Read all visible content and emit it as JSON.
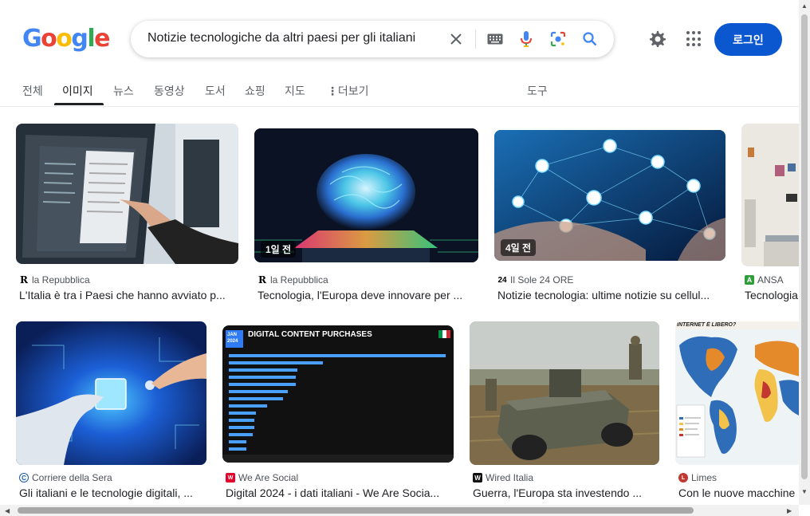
{
  "header": {
    "logo_letters": [
      {
        "ch": "G",
        "color": "#4285F4"
      },
      {
        "ch": "o",
        "color": "#EA4335"
      },
      {
        "ch": "o",
        "color": "#FBBC05"
      },
      {
        "ch": "g",
        "color": "#4285F4"
      },
      {
        "ch": "l",
        "color": "#34A853"
      },
      {
        "ch": "e",
        "color": "#EA4335"
      }
    ],
    "search_query": "Notizie tecnologiche da altri paesi per gli italiani",
    "login_label": "로그인"
  },
  "tabs": [
    {
      "label": "전체"
    },
    {
      "label": "이미지"
    },
    {
      "label": "뉴스"
    },
    {
      "label": "동영상"
    },
    {
      "label": "도서"
    },
    {
      "label": "쇼핑"
    },
    {
      "label": "지도"
    },
    {
      "label": "더보기"
    },
    {
      "label": "도구"
    }
  ],
  "results": [
    {
      "source": "la Repubblica",
      "title": "L'Italia è tra i Paesi che hanno avviato p...",
      "badge": ""
    },
    {
      "source": "la Repubblica",
      "title": "Tecnologia, l'Europa deve innovare per ...",
      "badge": "1일 전"
    },
    {
      "source": "Il Sole 24 ORE",
      "title": "Notizie tecnologia: ultime notizie su cellul...",
      "badge": "4일 전"
    },
    {
      "source": "ANSA",
      "title": "Tecnologia",
      "badge": ""
    },
    {
      "source": "Corriere della Sera",
      "title": "Gli italiani e le tecnologie digitali, ...",
      "badge": ""
    },
    {
      "source": "We Are Social",
      "title": "Digital 2024 - i dati italiani - We Are Socia...",
      "badge": "",
      "image_text": {
        "date": "JAN 2024",
        "heading": "DIGITAL CONTENT PURCHASES"
      }
    },
    {
      "source": "Wired Italia",
      "title": "Guerra, l'Europa sta investendo ...",
      "badge": ""
    },
    {
      "source": "Limes",
      "title": "Con le nuove macchine",
      "badge": "",
      "image_text": {
        "heading": "INTERNET È LIBERO?"
      }
    }
  ],
  "colors": {
    "accent": "#0b57d0",
    "text": "#202124",
    "muted": "#5f6368"
  }
}
